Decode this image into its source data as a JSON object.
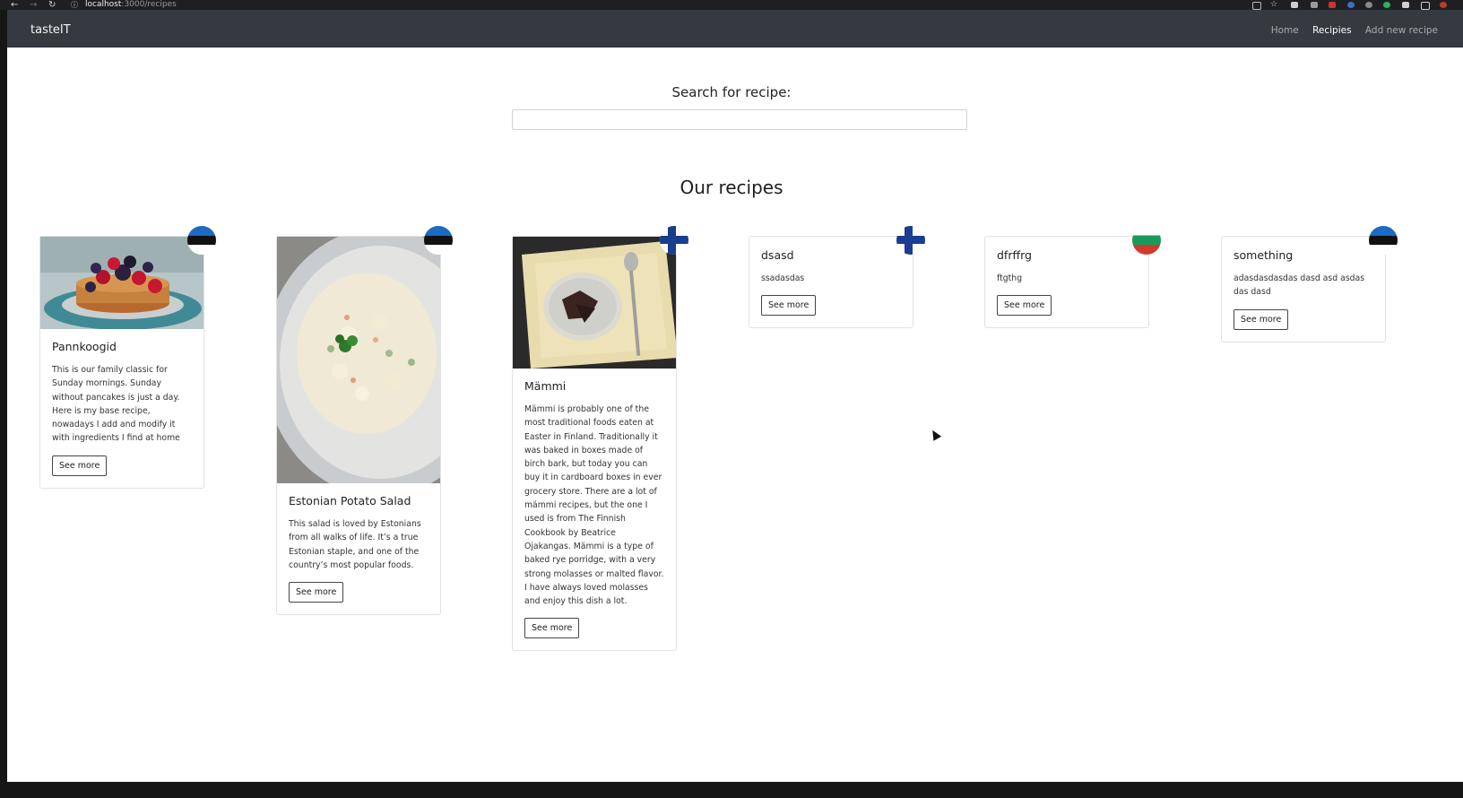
{
  "browser": {
    "url_host": "localhost",
    "url_path": ":3000/recipes",
    "back_icon": "arrow-left-icon",
    "forward_icon": "arrow-right-icon",
    "reload_icon": "reload-icon",
    "info_icon": "info-icon"
  },
  "navbar": {
    "brand": "tasteIT",
    "links": [
      {
        "label": "Home",
        "active": false
      },
      {
        "label": "Recipies",
        "active": true
      },
      {
        "label": "Add new recipe",
        "active": false
      }
    ]
  },
  "search": {
    "title": "Search for recipe:",
    "placeholder": "",
    "value": ""
  },
  "recipes_title": "Our recipes",
  "cards": [
    {
      "title": "Pannkoogid",
      "text": "This is our family classic for Sunday mornings. Sunday without pancakes is just a day. Here is my base recipe, nowadays I add and modify it with ingredients I find at home",
      "button": "See more",
      "flag": "estonia-flag",
      "image": "pancakes-photo"
    },
    {
      "title": "Estonian Potato Salad",
      "text": "This salad is loved by Estonians from all walks of life. It’s a true Estonian staple, and one of the country’s most popular foods.",
      "button": "See more",
      "flag": "estonia-flag",
      "image": "potato-salad-photo"
    },
    {
      "title": "Mämmi",
      "text": "Mämmi is probably one of the most traditional foods eaten at Easter in Finland. Traditionally it was baked in boxes made of birch bark, but today you can buy it in cardboard boxes in ever grocery store. There are a lot of mämmi recipes, but the one I used is from The Finnish Cookbook by Beatrice Ojakangas. Mämmi is a type of baked rye porridge, with a very strong molasses or malted flavor. I have always loved molasses and enjoy this dish a lot.",
      "button": "See more",
      "flag": "finland-flag",
      "image": "mammi-photo"
    },
    {
      "title": "dsasd",
      "text": "ssadasdas",
      "button": "See more",
      "flag": "finland-flag"
    },
    {
      "title": "dfrffrg",
      "text": "ftgthg",
      "button": "See more",
      "flag": "bulgaria-flag"
    },
    {
      "title": "something",
      "text": "adasdasdasdas dasd asd asdas das dasd",
      "button": "See more",
      "flag": "estonia-flag"
    }
  ]
}
